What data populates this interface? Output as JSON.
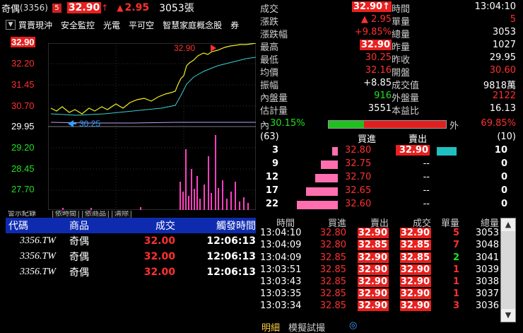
{
  "header": {
    "stock_name": "奇偶",
    "stock_code": "(3356)",
    "badge": "5",
    "price": "32.90",
    "price_arrow": "↑",
    "change_tri": "▲",
    "change": "2.95",
    "volume": "3053張"
  },
  "menu": {
    "items": [
      "買賣現沖",
      "安全監控",
      "光電",
      "平可空",
      "智慧家庭概念股",
      "券"
    ]
  },
  "chart": {
    "y_labels": [
      "32.90",
      "32.20",
      "31.45",
      "30.70",
      "29.95",
      "29.20",
      "28.45",
      "27.70"
    ],
    "high_marker": "32.90",
    "prev_close_marker": "30.25",
    "ylim": [
      27.3,
      33.1
    ]
  },
  "trades": {
    "tabs": [
      "警示紀錄",
      "依時間",
      "依商品",
      "清除"
    ],
    "headers": {
      "code": "代碼",
      "name": "商品",
      "price": "成交",
      "time": "觸發時間"
    },
    "rows": [
      {
        "code": "3356.TW",
        "name": "奇偶",
        "price": "32.00",
        "time": "12:06:13"
      },
      {
        "code": "3356.TW",
        "name": "奇偶",
        "price": "32.00",
        "time": "12:06:13"
      },
      {
        "code": "3356.TW",
        "name": "奇偶",
        "price": "32.00",
        "time": "12:06:13"
      }
    ]
  },
  "quote": {
    "rows": [
      {
        "l1": "成交",
        "v1": "32.90↑",
        "l2": "時間",
        "v2": "13:04:10"
      },
      {
        "l1": "漲跌",
        "v1": "▲ 2.95",
        "l2": "單量",
        "v2": "5"
      },
      {
        "l1": "漲跌幅",
        "v1": "+9.85%",
        "l2": "總量",
        "v2": "3053"
      },
      {
        "l1": "最高",
        "v1": "32.90",
        "l2": "昨量",
        "v2": "1027"
      },
      {
        "l1": "最低",
        "v1": "30.25",
        "l2": "昨收",
        "v2": "29.95"
      },
      {
        "l1": "均價",
        "v1": "32.16",
        "l2": "開盤",
        "v2": "30.60"
      },
      {
        "l1": "振幅",
        "v1": "+8.85",
        "l2": "成交值",
        "v2": "9818萬"
      },
      {
        "l1": "內盤量",
        "v1": "916",
        "l2": "外盤量",
        "v2": "2122"
      },
      {
        "l1": "估計量",
        "v1": "3551",
        "l2": "本益比",
        "v2": "16.13"
      }
    ],
    "inner_label": "內",
    "inner_pct": "30.15%",
    "outer_label": "外",
    "outer_pct": "69.85%",
    "inner_fraction": 0.3015
  },
  "book": {
    "bid_count": "(63)",
    "bid_header": "買進",
    "ask_header": "賣出",
    "ask_count": "(10)",
    "rows": [
      {
        "bid_qty": "3",
        "bid_px": "32.80",
        "ask_px": "32.90",
        "ask_qty": "10",
        "bid_ratio": 0.14,
        "ask_ratio": 1.0
      },
      {
        "bid_qty": "9",
        "bid_px": "32.75",
        "ask_px": "--",
        "ask_qty": "0",
        "bid_ratio": 0.41,
        "ask_ratio": 0
      },
      {
        "bid_qty": "12",
        "bid_px": "32.70",
        "ask_px": "--",
        "ask_qty": "0",
        "bid_ratio": 0.55,
        "ask_ratio": 0
      },
      {
        "bid_qty": "17",
        "bid_px": "32.65",
        "ask_px": "--",
        "ask_qty": "0",
        "bid_ratio": 0.77,
        "ask_ratio": 0
      },
      {
        "bid_qty": "22",
        "bid_px": "32.60",
        "ask_px": "--",
        "ask_qty": "0",
        "bid_ratio": 1.0,
        "ask_ratio": 0
      }
    ]
  },
  "ticks": {
    "headers": {
      "time": "時間",
      "bid": "買進",
      "ask": "賣出",
      "price": "成交",
      "qty": "單量",
      "total": "總量"
    },
    "rows": [
      {
        "time": "13:04:10",
        "bid": "32.80",
        "ask": "32.90",
        "price": "32.90",
        "qty": "5",
        "total": "3053",
        "qty_color": "#ff3030"
      },
      {
        "time": "13:04:09",
        "bid": "32.80",
        "ask": "32.85",
        "price": "32.85",
        "qty": "7",
        "total": "3048",
        "qty_color": "#ff3030"
      },
      {
        "time": "13:04:09",
        "bid": "32.85",
        "ask": "32.90",
        "price": "32.85",
        "qty": "2",
        "total": "3041",
        "qty_color": "#20e020"
      },
      {
        "time": "13:03:51",
        "bid": "32.85",
        "ask": "32.90",
        "price": "32.90",
        "qty": "1",
        "total": "3039",
        "qty_color": "#ff3030"
      },
      {
        "time": "13:03:43",
        "bid": "32.85",
        "ask": "32.90",
        "price": "32.90",
        "qty": "1",
        "total": "3038",
        "qty_color": "#ff3030"
      },
      {
        "time": "13:03:35",
        "bid": "32.85",
        "ask": "32.90",
        "price": "32.90",
        "qty": "1",
        "total": "3037",
        "qty_color": "#ff3030"
      },
      {
        "time": "13:03:34",
        "bid": "32.85",
        "ask": "32.90",
        "price": "32.90",
        "qty": "3",
        "total": "3036",
        "qty_color": "#ff3030"
      }
    ]
  },
  "bottom_tabs": {
    "detail": "明細",
    "simulate": "模擬試撮"
  },
  "colors": {
    "up": "#ff3030",
    "down": "#20e020",
    "price_box": "#e8201e",
    "header_blue": "#0e2bb0",
    "bid_bar": "#ff6fb0",
    "ask_bar": "#20c0c0"
  }
}
